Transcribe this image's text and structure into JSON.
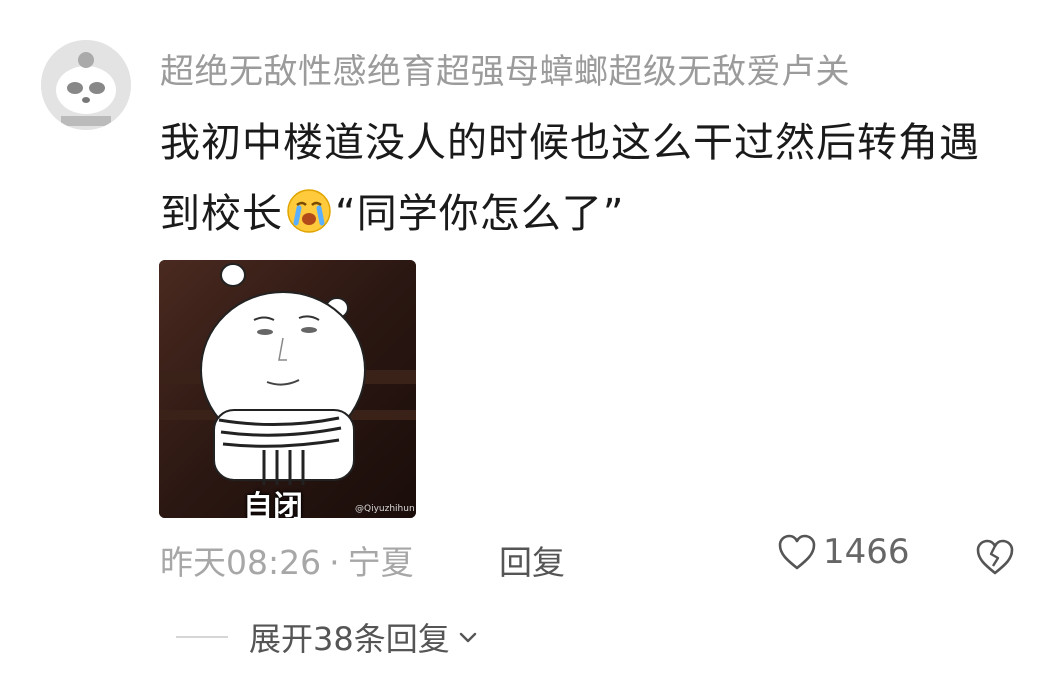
{
  "comment": {
    "username": "超绝无敌性感绝育超强母蟑螂超级无敌爱卢关",
    "text_part1": "我初中楼道没人的时候也这么干过然后转角遇到校长",
    "inline_emoji": "crying-emoji",
    "text_part2": "“同学你怎么了”",
    "sticker": {
      "caption": "自闭",
      "watermark": "@Qiyuzhihun"
    },
    "time": "昨天08:26",
    "separator": "·",
    "location": "宁夏",
    "reply_label": "回复",
    "like_count": "1466",
    "expand_replies_label": "展开38条回复"
  },
  "colors": {
    "username": "#9b9b9b",
    "text": "#1a1a1a",
    "meta": "#a7a7a7"
  }
}
